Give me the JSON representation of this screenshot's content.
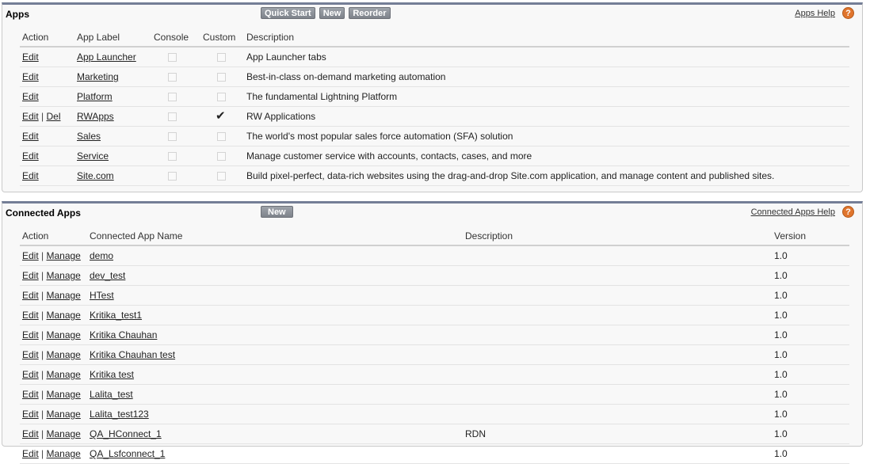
{
  "apps": {
    "title": "Apps",
    "buttons": [
      "Quick Start",
      "New",
      "Reorder"
    ],
    "help": "Apps Help",
    "help_icon": "?",
    "columns": [
      "Action",
      "App Label",
      "Console",
      "Custom",
      "Description"
    ],
    "rows": [
      {
        "actions": [
          "Edit"
        ],
        "label": "App Launcher",
        "console": false,
        "custom": false,
        "description": "App Launcher tabs"
      },
      {
        "actions": [
          "Edit"
        ],
        "label": "Marketing",
        "console": false,
        "custom": false,
        "description": "Best-in-class on-demand marketing automation"
      },
      {
        "actions": [
          "Edit"
        ],
        "label": "Platform",
        "console": false,
        "custom": false,
        "description": "The fundamental Lightning Platform"
      },
      {
        "actions": [
          "Edit",
          "Del"
        ],
        "label": "RWApps",
        "console": false,
        "custom": true,
        "description": "RW Applications"
      },
      {
        "actions": [
          "Edit"
        ],
        "label": "Sales",
        "console": false,
        "custom": false,
        "description": "The world's most popular sales force automation (SFA) solution"
      },
      {
        "actions": [
          "Edit"
        ],
        "label": "Service",
        "console": false,
        "custom": false,
        "description": "Manage customer service with accounts, contacts, cases, and more"
      },
      {
        "actions": [
          "Edit"
        ],
        "label": "Site.com",
        "console": false,
        "custom": false,
        "description": "Build pixel-perfect, data-rich websites using the drag-and-drop Site.com application, and manage content and published sites."
      }
    ]
  },
  "connected": {
    "title": "Connected Apps",
    "buttons": [
      "New"
    ],
    "help": "Connected Apps Help",
    "help_icon": "?",
    "columns": [
      "Action",
      "Connected App Name",
      "Description",
      "Version"
    ],
    "rows": [
      {
        "actions": [
          "Edit",
          "Manage"
        ],
        "name": "demo",
        "description": "",
        "version": "1.0"
      },
      {
        "actions": [
          "Edit",
          "Manage"
        ],
        "name": "dev_test",
        "description": "",
        "version": "1.0"
      },
      {
        "actions": [
          "Edit",
          "Manage"
        ],
        "name": "HTest",
        "description": "",
        "version": "1.0"
      },
      {
        "actions": [
          "Edit",
          "Manage"
        ],
        "name": "Kritika_test1",
        "description": "",
        "version": "1.0"
      },
      {
        "actions": [
          "Edit",
          "Manage"
        ],
        "name": "Kritika Chauhan",
        "description": "",
        "version": "1.0"
      },
      {
        "actions": [
          "Edit",
          "Manage"
        ],
        "name": "Kritika Chauhan test",
        "description": "",
        "version": "1.0"
      },
      {
        "actions": [
          "Edit",
          "Manage"
        ],
        "name": "Kritika test",
        "description": "",
        "version": "1.0"
      },
      {
        "actions": [
          "Edit",
          "Manage"
        ],
        "name": "Lalita_test",
        "description": "",
        "version": "1.0"
      },
      {
        "actions": [
          "Edit",
          "Manage"
        ],
        "name": "Lalita_test123",
        "description": "",
        "version": "1.0"
      },
      {
        "actions": [
          "Edit",
          "Manage"
        ],
        "name": "QA_HConnect_1",
        "description": "RDN",
        "version": "1.0"
      },
      {
        "actions": [
          "Edit",
          "Manage"
        ],
        "name": "QA_Lsfconnect_1",
        "description": "",
        "version": "1.0"
      }
    ]
  }
}
